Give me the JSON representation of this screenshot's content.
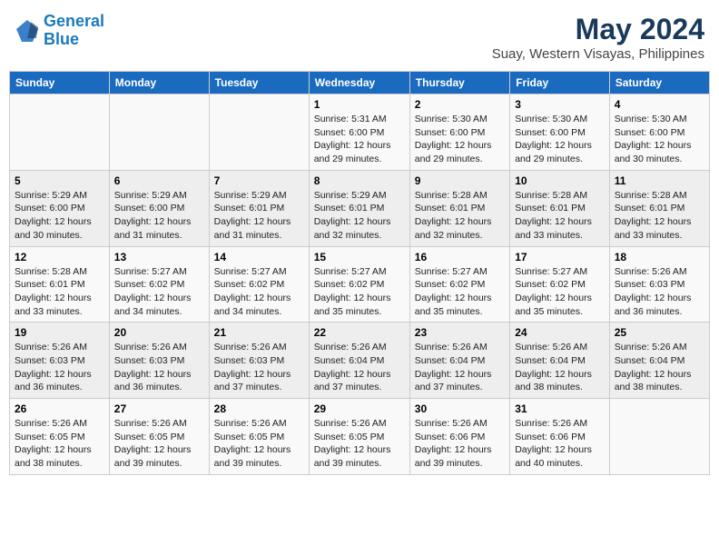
{
  "header": {
    "logo_line1": "General",
    "logo_line2": "Blue",
    "month_year": "May 2024",
    "location": "Suay, Western Visayas, Philippines"
  },
  "weekdays": [
    "Sunday",
    "Monday",
    "Tuesday",
    "Wednesday",
    "Thursday",
    "Friday",
    "Saturday"
  ],
  "weeks": [
    [
      {
        "day": "",
        "info": ""
      },
      {
        "day": "",
        "info": ""
      },
      {
        "day": "",
        "info": ""
      },
      {
        "day": "1",
        "info": "Sunrise: 5:31 AM\nSunset: 6:00 PM\nDaylight: 12 hours and 29 minutes."
      },
      {
        "day": "2",
        "info": "Sunrise: 5:30 AM\nSunset: 6:00 PM\nDaylight: 12 hours and 29 minutes."
      },
      {
        "day": "3",
        "info": "Sunrise: 5:30 AM\nSunset: 6:00 PM\nDaylight: 12 hours and 29 minutes."
      },
      {
        "day": "4",
        "info": "Sunrise: 5:30 AM\nSunset: 6:00 PM\nDaylight: 12 hours and 30 minutes."
      }
    ],
    [
      {
        "day": "5",
        "info": "Sunrise: 5:29 AM\nSunset: 6:00 PM\nDaylight: 12 hours and 30 minutes."
      },
      {
        "day": "6",
        "info": "Sunrise: 5:29 AM\nSunset: 6:00 PM\nDaylight: 12 hours and 31 minutes."
      },
      {
        "day": "7",
        "info": "Sunrise: 5:29 AM\nSunset: 6:01 PM\nDaylight: 12 hours and 31 minutes."
      },
      {
        "day": "8",
        "info": "Sunrise: 5:29 AM\nSunset: 6:01 PM\nDaylight: 12 hours and 32 minutes."
      },
      {
        "day": "9",
        "info": "Sunrise: 5:28 AM\nSunset: 6:01 PM\nDaylight: 12 hours and 32 minutes."
      },
      {
        "day": "10",
        "info": "Sunrise: 5:28 AM\nSunset: 6:01 PM\nDaylight: 12 hours and 33 minutes."
      },
      {
        "day": "11",
        "info": "Sunrise: 5:28 AM\nSunset: 6:01 PM\nDaylight: 12 hours and 33 minutes."
      }
    ],
    [
      {
        "day": "12",
        "info": "Sunrise: 5:28 AM\nSunset: 6:01 PM\nDaylight: 12 hours and 33 minutes."
      },
      {
        "day": "13",
        "info": "Sunrise: 5:27 AM\nSunset: 6:02 PM\nDaylight: 12 hours and 34 minutes."
      },
      {
        "day": "14",
        "info": "Sunrise: 5:27 AM\nSunset: 6:02 PM\nDaylight: 12 hours and 34 minutes."
      },
      {
        "day": "15",
        "info": "Sunrise: 5:27 AM\nSunset: 6:02 PM\nDaylight: 12 hours and 35 minutes."
      },
      {
        "day": "16",
        "info": "Sunrise: 5:27 AM\nSunset: 6:02 PM\nDaylight: 12 hours and 35 minutes."
      },
      {
        "day": "17",
        "info": "Sunrise: 5:27 AM\nSunset: 6:02 PM\nDaylight: 12 hours and 35 minutes."
      },
      {
        "day": "18",
        "info": "Sunrise: 5:26 AM\nSunset: 6:03 PM\nDaylight: 12 hours and 36 minutes."
      }
    ],
    [
      {
        "day": "19",
        "info": "Sunrise: 5:26 AM\nSunset: 6:03 PM\nDaylight: 12 hours and 36 minutes."
      },
      {
        "day": "20",
        "info": "Sunrise: 5:26 AM\nSunset: 6:03 PM\nDaylight: 12 hours and 36 minutes."
      },
      {
        "day": "21",
        "info": "Sunrise: 5:26 AM\nSunset: 6:03 PM\nDaylight: 12 hours and 37 minutes."
      },
      {
        "day": "22",
        "info": "Sunrise: 5:26 AM\nSunset: 6:04 PM\nDaylight: 12 hours and 37 minutes."
      },
      {
        "day": "23",
        "info": "Sunrise: 5:26 AM\nSunset: 6:04 PM\nDaylight: 12 hours and 37 minutes."
      },
      {
        "day": "24",
        "info": "Sunrise: 5:26 AM\nSunset: 6:04 PM\nDaylight: 12 hours and 38 minutes."
      },
      {
        "day": "25",
        "info": "Sunrise: 5:26 AM\nSunset: 6:04 PM\nDaylight: 12 hours and 38 minutes."
      }
    ],
    [
      {
        "day": "26",
        "info": "Sunrise: 5:26 AM\nSunset: 6:05 PM\nDaylight: 12 hours and 38 minutes."
      },
      {
        "day": "27",
        "info": "Sunrise: 5:26 AM\nSunset: 6:05 PM\nDaylight: 12 hours and 39 minutes."
      },
      {
        "day": "28",
        "info": "Sunrise: 5:26 AM\nSunset: 6:05 PM\nDaylight: 12 hours and 39 minutes."
      },
      {
        "day": "29",
        "info": "Sunrise: 5:26 AM\nSunset: 6:05 PM\nDaylight: 12 hours and 39 minutes."
      },
      {
        "day": "30",
        "info": "Sunrise: 5:26 AM\nSunset: 6:06 PM\nDaylight: 12 hours and 39 minutes."
      },
      {
        "day": "31",
        "info": "Sunrise: 5:26 AM\nSunset: 6:06 PM\nDaylight: 12 hours and 40 minutes."
      },
      {
        "day": "",
        "info": ""
      }
    ]
  ]
}
